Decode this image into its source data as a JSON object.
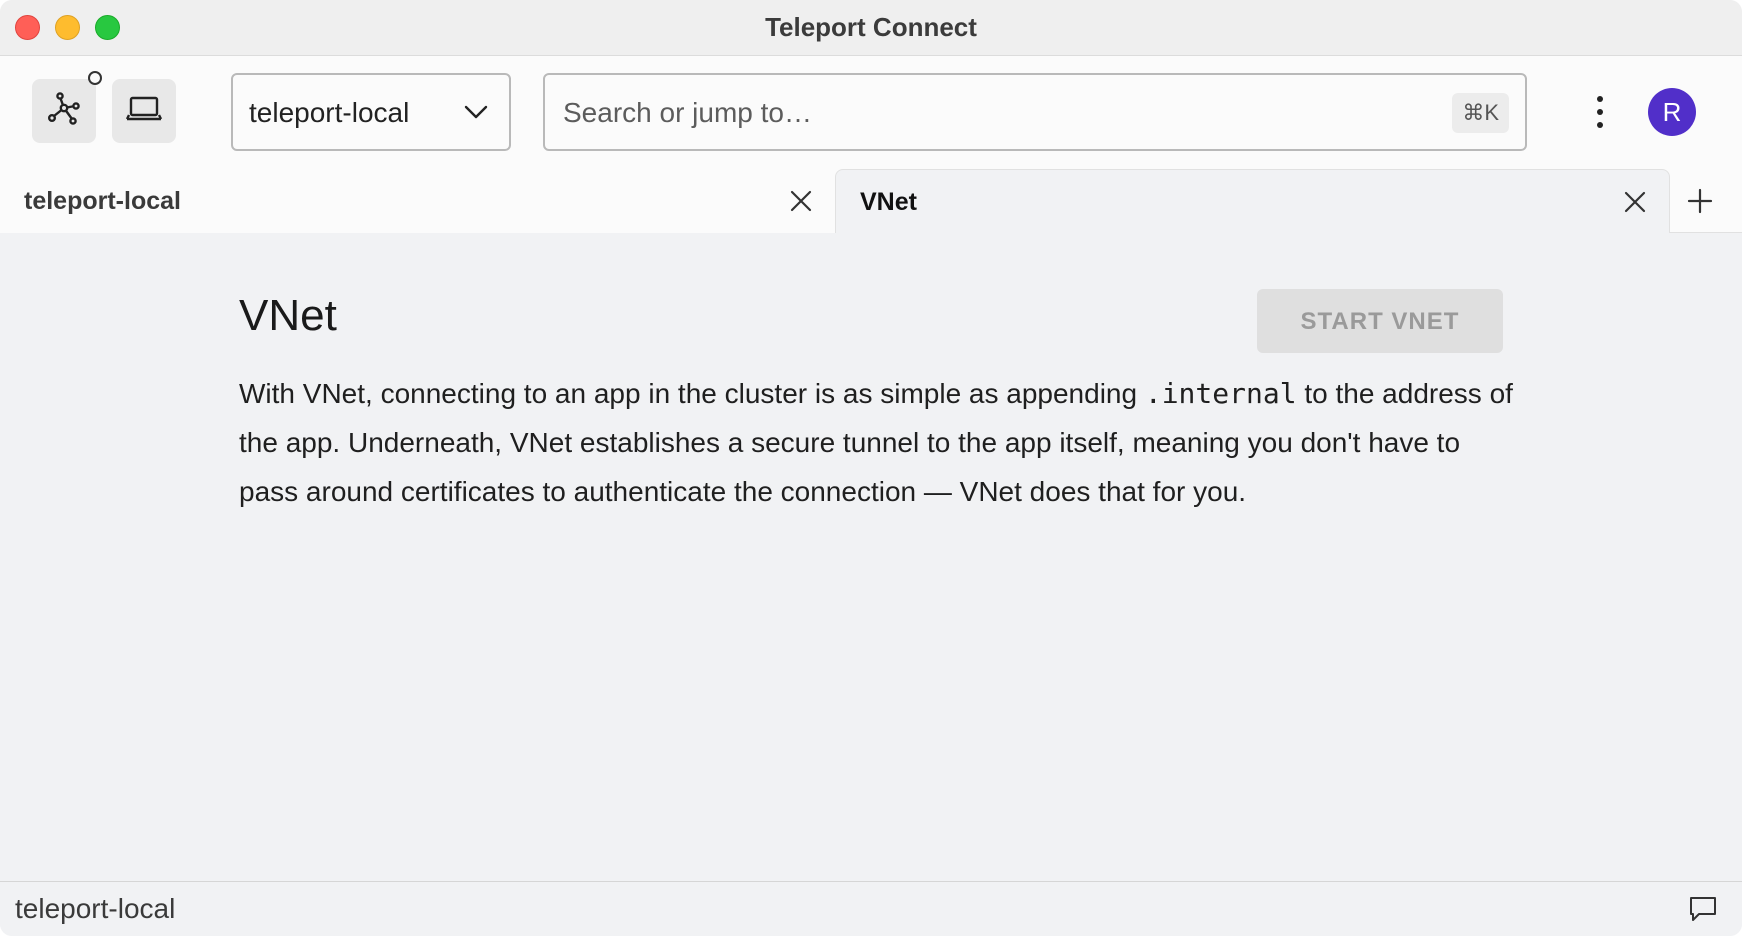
{
  "window": {
    "title": "Teleport Connect"
  },
  "topbar": {
    "cluster_select": {
      "value": "teleport-local"
    },
    "search": {
      "placeholder": "Search or jump to…",
      "shortcut": "⌘K"
    },
    "avatar_initial": "R",
    "icons": {
      "connections": "network-icon",
      "vnet": "laptop-icon",
      "more": "more-vertical-icon",
      "status": "status-circle-icon"
    }
  },
  "tabs": [
    {
      "label": "teleport-local",
      "active": false
    },
    {
      "label": "VNet",
      "active": true
    }
  ],
  "main": {
    "title": "VNet",
    "start_button": "START VNET",
    "description": {
      "before": "With VNet, connecting to an app in the cluster is as simple as appending ",
      "code": ".internal",
      "after": " to the address of the app. Underneath, VNet establishes a secure tunnel to the app itself, meaning you don't have to pass around certificates to authenticate the connection — VNet does that for you."
    }
  },
  "statusbar": {
    "cluster": "teleport-local"
  },
  "colors": {
    "accent": "#512fc9",
    "close": "#ff5f57",
    "minimize": "#febc2e",
    "maximize": "#28c840"
  }
}
